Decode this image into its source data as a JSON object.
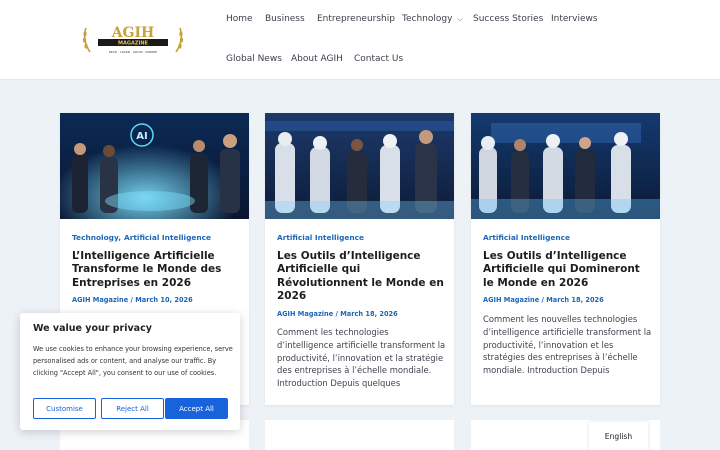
{
  "brand": {
    "name": "AGIH",
    "ribbon": "MAGAZINE",
    "tagline": "READ · LEARN · GROW · INSPIRE"
  },
  "nav": {
    "items": [
      "Home",
      "Business",
      "Entrepreneurship",
      "Technology",
      "Success Stories",
      "Interviews",
      "Global News",
      "About AGIH",
      "Contact Us"
    ]
  },
  "posts": [
    {
      "categories": [
        "Technology",
        "Artificial Intelligence"
      ],
      "title": "L’Intelligence Artificielle Transforme le Monde des Entreprises en 2026",
      "meta": "AGIH Magazine / March 10, 2026",
      "excerpt": "",
      "image_icon": "ai-business-team-image"
    },
    {
      "categories": [
        "Artificial Intelligence"
      ],
      "title": "Les Outils d’Intelligence Artificielle qui Révolutionnent le Monde en 2026",
      "meta": "AGIH Magazine / March 18, 2026",
      "excerpt": "Comment les technologies d’intelligence artificielle transforment la productivité, l’innovation et la stratégie des entreprises à l’échelle mondiale. Introduction Depuis quelques",
      "image_icon": "robots-and-people-image"
    },
    {
      "categories": [
        "Artificial Intelligence"
      ],
      "title": "Les Outils d’Intelligence Artificielle qui Domineront le Monde en 2026",
      "meta": "AGIH Magazine / March 18, 2026",
      "excerpt": "Comment les nouvelles technologies d’intelligence artificielle transforment la productivité, l’innovation et les stratégies des entreprises à l’échelle mondiale. Introduction Depuis",
      "image_icon": "robots-lab-image"
    }
  ],
  "cookie": {
    "title": "We value your privacy",
    "text": "We use cookies to enhance your browsing experience, serve personalised ads or content, and analyse our traffic. By clicking \"Accept All\", you consent to our use of cookies.",
    "customise": "Customise",
    "reject": "Reject All",
    "accept": "Accept All"
  },
  "language": "English",
  "colors": {
    "accent": "#1c66b8",
    "button": "#1863dc",
    "background": "#edf2f7",
    "gold": "#c9a13b"
  },
  "image_labels": {
    "ai_badge": "AI"
  }
}
